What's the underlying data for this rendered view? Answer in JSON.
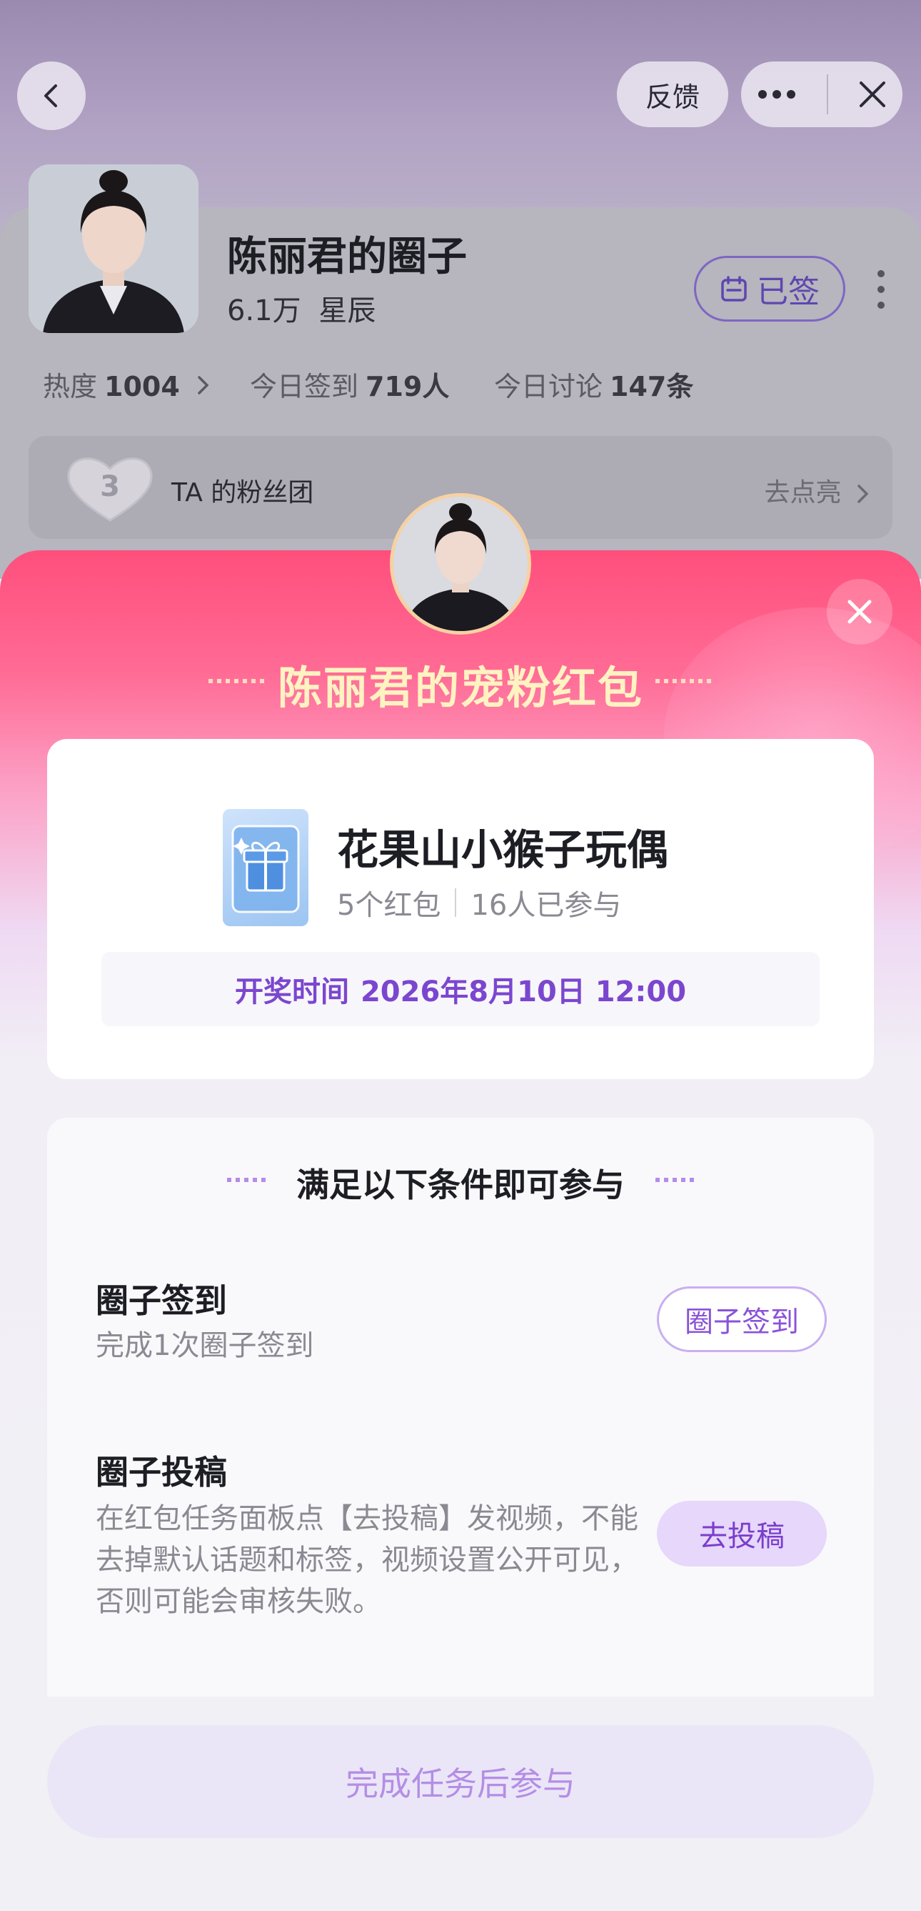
{
  "nav": {
    "feedback_label": "反馈"
  },
  "circle": {
    "title": "陈丽君的圈子",
    "members": "6.1万",
    "members_unit": "星辰",
    "signed_label": "已签",
    "stats": [
      {
        "label": "热度",
        "value": "1004"
      },
      {
        "label": "今日签到",
        "value": "719人"
      },
      {
        "label": "今日讨论",
        "value": "147条"
      }
    ],
    "fan_group": {
      "level": "3",
      "label": "TA 的粉丝团",
      "action": "去点亮"
    }
  },
  "modal": {
    "title": "陈丽君的宠粉红包",
    "prize": {
      "name": "花果山小猴子玩偶",
      "count": "5个红包",
      "participants": "16人已参与",
      "draw_label": "开奖时间",
      "draw_time": "2026年8月10日 12:00"
    },
    "conditions": {
      "header": "满足以下条件即可参与",
      "tasks": [
        {
          "title": "圈子签到",
          "desc": "完成1次圈子签到",
          "button": "圈子签到"
        },
        {
          "title": "圈子投稿",
          "desc": "在红包任务面板点【去投稿】发视频，不能去掉默认话题和标签，视频设置公开可见，否则可能会审核失败。",
          "button": "去投稿"
        }
      ]
    },
    "bottom_button": "完成任务后参与"
  },
  "colors": {
    "accent_purple": "#7b46cf",
    "modal_pink": "#ff4f7c",
    "title_gold": "#fff3c2"
  }
}
